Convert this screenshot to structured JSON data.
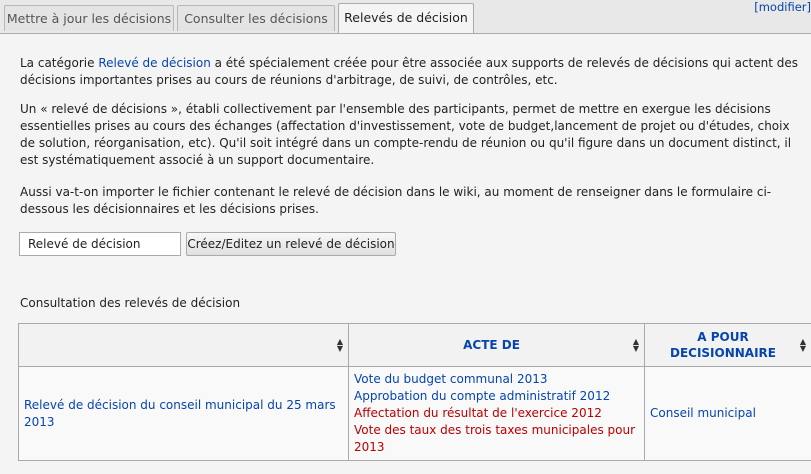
{
  "tabs": [
    {
      "label": "Mettre à jour les décisions"
    },
    {
      "label": "Consulter les décisions"
    },
    {
      "label": "Relevés de décision"
    }
  ],
  "edit_link": "[modifier]",
  "intro": {
    "p1_before": "La catégorie ",
    "p1_link": "Relevé de décision",
    "p1_after": " a été spécialement créée pour être associée aux supports de relevés de décisions qui actent des décisions importantes prises au cours de réunions d'arbitrage, de suivi, de contrôles, etc.",
    "p2": "Un « relevé de décisions », établi collectivement par l'ensemble des participants, permet de mettre en exergue les décisions essentielles prises au cours des échanges (affectation d'investissement, vote de budget,lancement de projet ou d'études, choix de solution, réorganisation, etc). Qu'il soit intégré dans un compte-rendu de réunion ou qu'il figure dans un document distinct, il est systématiquement associé à un support documentaire.",
    "p3": "Aussi va-t-on importer le fichier contenant le relevé de décision dans le wiki, au moment de renseigner dans le formulaire ci-dessous les décisionnaires et les décisions prises."
  },
  "form": {
    "input_value": "Relevé de décision",
    "button_label": "Créez/Editez un relevé de décision"
  },
  "section_title": "Consultation des relevés de décision",
  "table": {
    "headers": [
      "",
      "ACTE DE",
      "A POUR DECISIONNAIRE"
    ],
    "rows": [
      {
        "title": "Relevé de décision du conseil municipal du 25 mars 2013",
        "acts": [
          {
            "label": "Vote du budget communal 2013"
          },
          {
            "label": "Approbation du compte administratif 2012"
          },
          {
            "label": "Affectation du résultat de l'exercice 2012"
          },
          {
            "label": "Vote des taux des trois taxes municipales pour 2013"
          }
        ],
        "decider": "Conseil municipal"
      }
    ]
  },
  "colors": {
    "link": "#0645ad",
    "redlink": "#ba0000"
  }
}
